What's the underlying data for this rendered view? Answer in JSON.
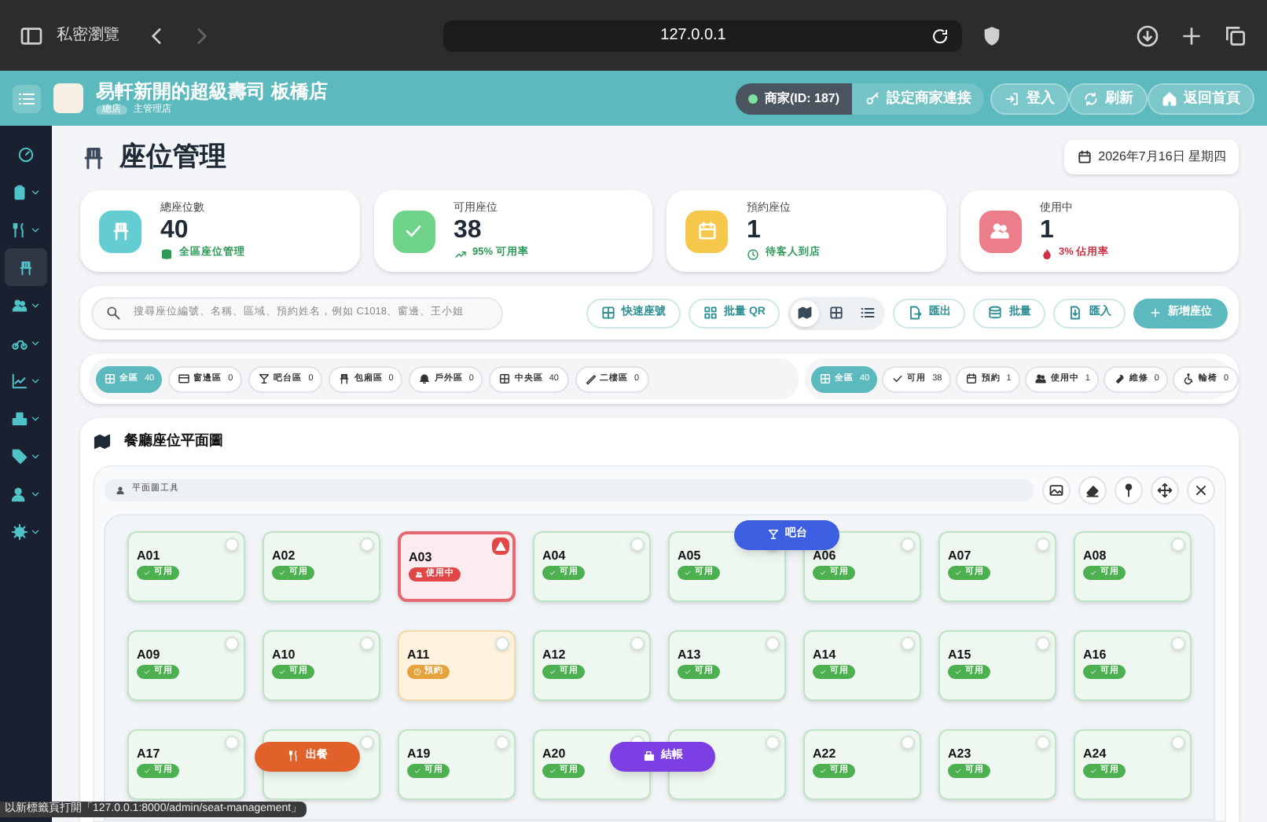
{
  "browser": {
    "tab_label": "私密瀏覽",
    "url": "127.0.0.1"
  },
  "header": {
    "store_name": "易軒新開的超級壽司 板橋店",
    "store_tag": "總店",
    "store_note": "主管理店",
    "merchant": "商家(ID: 187)",
    "buttons": [
      {
        "label": "設定商家連接",
        "kind": "key"
      },
      {
        "label": "登入",
        "kind": "login"
      },
      {
        "label": "刷新",
        "kind": "refresh"
      },
      {
        "label": "返回首頁",
        "kind": "home"
      }
    ]
  },
  "sidebar": {
    "items": [
      {
        "kind": "gauge",
        "expandable": false,
        "selected": false
      },
      {
        "kind": "clipboard",
        "expandable": true,
        "selected": false
      },
      {
        "kind": "utensils",
        "expandable": true,
        "selected": false
      },
      {
        "kind": "chair",
        "expandable": false,
        "selected": true
      },
      {
        "kind": "people",
        "expandable": true,
        "selected": false
      },
      {
        "kind": "bike",
        "expandable": true,
        "selected": false
      },
      {
        "kind": "chart",
        "expandable": true,
        "selected": false
      },
      {
        "kind": "boxes",
        "expandable": true,
        "selected": false
      },
      {
        "kind": "tag",
        "expandable": true,
        "selected": false
      },
      {
        "kind": "user",
        "expandable": true,
        "selected": false
      },
      {
        "kind": "gear",
        "expandable": true,
        "selected": false
      }
    ]
  },
  "page": {
    "title": "座位管理",
    "date": "2026年7月16日 星期四"
  },
  "stats": [
    {
      "label": "總座位數",
      "value": "40",
      "note": "全區座位管理",
      "color": "#63cdd2",
      "kind": "chair",
      "alert": false
    },
    {
      "label": "可用座位",
      "value": "38",
      "note": "95% 可用率",
      "color": "#6fd48a",
      "kind": "check",
      "alert": false
    },
    {
      "label": "預約座位",
      "value": "1",
      "note": "待客人到店",
      "color": "#f5c84c",
      "kind": "calendar",
      "alert": false
    },
    {
      "label": "使用中",
      "value": "1",
      "note": "3% 佔用率",
      "color": "#ec7d8a",
      "kind": "people",
      "alert": true
    }
  ],
  "toolbar": {
    "search_placeholder": "搜尋座位編號、名稱、區域、預約姓名，例如 C1018、窗邊、王小姐",
    "tools": [
      {
        "label": "快速座號",
        "kind": "grid"
      },
      {
        "label": "批量 QR",
        "kind": "qr"
      }
    ],
    "views": [
      {
        "kind": "map",
        "selected": true
      },
      {
        "kind": "grid",
        "selected": false
      },
      {
        "kind": "list",
        "selected": false
      }
    ],
    "actions": [
      {
        "label": "匯出",
        "kind": "export"
      },
      {
        "label": "批量",
        "kind": "stack"
      },
      {
        "label": "匯入",
        "kind": "import"
      }
    ],
    "primary": "新增座位"
  },
  "zones": [
    {
      "label": "全區",
      "count": "40",
      "selected": true,
      "kind": "grid"
    },
    {
      "label": "窗邊區",
      "count": "0",
      "selected": false,
      "kind": "window"
    },
    {
      "label": "吧台區",
      "count": "0",
      "selected": false,
      "kind": "cocktail"
    },
    {
      "label": "包廂區",
      "count": "0",
      "selected": false,
      "kind": "chair"
    },
    {
      "label": "戶外區",
      "count": "0",
      "selected": false,
      "kind": "bell"
    },
    {
      "label": "中央區",
      "count": "40",
      "selected": false,
      "kind": "grid"
    },
    {
      "label": "二樓區",
      "count": "0",
      "selected": false,
      "kind": "slash"
    }
  ],
  "status_filters": [
    {
      "label": "全區",
      "count": "40",
      "selected": true,
      "kind": "grid"
    },
    {
      "label": "可用",
      "count": "38",
      "selected": false,
      "kind": "check"
    },
    {
      "label": "預約",
      "count": "1",
      "selected": false,
      "kind": "calendar"
    },
    {
      "label": "使用中",
      "count": "1",
      "selected": false,
      "kind": "people"
    },
    {
      "label": "維修",
      "count": "0",
      "selected": false,
      "kind": "wrench"
    },
    {
      "label": "輪椅",
      "count": "0",
      "selected": false,
      "kind": "wheelchair"
    }
  ],
  "floorplan": {
    "title": "餐廳座位平面圖",
    "tools_label": "平面圖工具",
    "tools": [
      {
        "kind": "image"
      },
      {
        "kind": "eraser"
      },
      {
        "kind": "pin"
      },
      {
        "kind": "move"
      },
      {
        "kind": "close"
      }
    ],
    "seats": [
      {
        "label": "A01",
        "kind": "available",
        "status_label": "可用"
      },
      {
        "label": "A02",
        "kind": "available",
        "status_label": "可用"
      },
      {
        "label": "A03",
        "kind": "occupied",
        "status_label": "使用中"
      },
      {
        "label": "A04",
        "kind": "available",
        "status_label": "可用"
      },
      {
        "label": "A05",
        "kind": "available",
        "status_label": "可用"
      },
      {
        "label": "A06",
        "kind": "available",
        "status_label": "可用"
      },
      {
        "label": "A07",
        "kind": "available",
        "status_label": "可用"
      },
      {
        "label": "A08",
        "kind": "available",
        "status_label": "可用"
      },
      {
        "label": "A09",
        "kind": "available",
        "status_label": "可用"
      },
      {
        "label": "A10",
        "kind": "available",
        "status_label": "可用"
      },
      {
        "label": "A11",
        "kind": "reserved",
        "status_label": "預約"
      },
      {
        "label": "A12",
        "kind": "available",
        "status_label": "可用"
      },
      {
        "label": "A13",
        "kind": "available",
        "status_label": "可用"
      },
      {
        "label": "A14",
        "kind": "available",
        "status_label": "可用"
      },
      {
        "label": "A15",
        "kind": "available",
        "status_label": "可用"
      },
      {
        "label": "A16",
        "kind": "available",
        "status_label": "可用"
      },
      {
        "label": "A17",
        "kind": "available",
        "status_label": "可用"
      },
      {
        "kind": "covered"
      },
      {
        "label": "A19",
        "kind": "available",
        "status_label": "可用"
      },
      {
        "label": "A20",
        "kind": "available",
        "status_label": "可用"
      },
      {
        "kind": "covered"
      },
      {
        "label": "A22",
        "kind": "available",
        "status_label": "可用"
      },
      {
        "label": "A23",
        "kind": "available",
        "status_label": "可用"
      },
      {
        "label": "A24",
        "kind": "available",
        "status_label": "可用"
      }
    ],
    "markers": [
      {
        "label": "吧台",
        "kind": "bar"
      },
      {
        "label": "出餐",
        "kind": "serve"
      },
      {
        "label": "結帳",
        "kind": "checkout"
      }
    ]
  },
  "link_preview": "以新標籤頁打開「127.0.0.1:8000/admin/seat-management」"
}
